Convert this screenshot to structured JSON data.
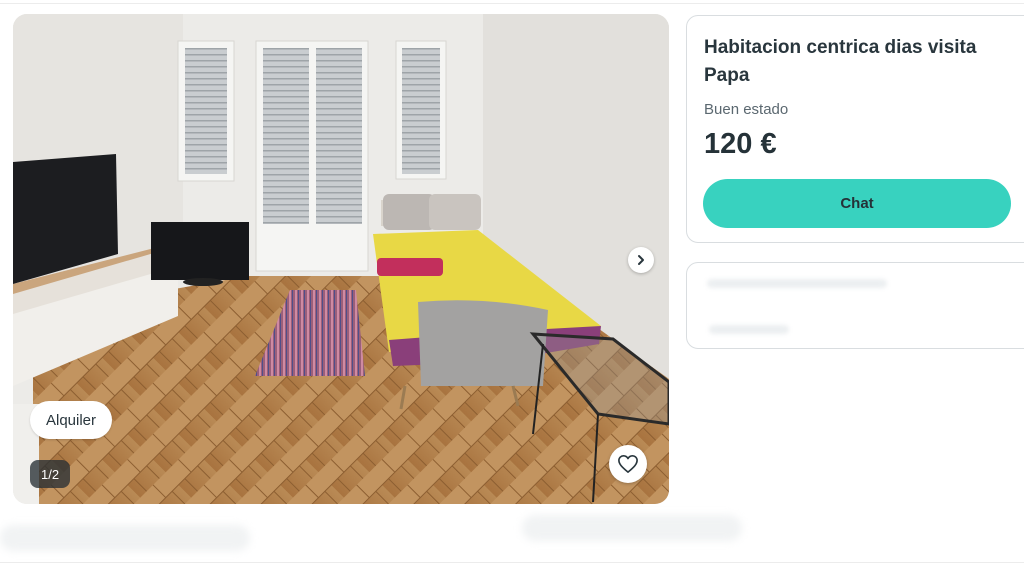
{
  "listing": {
    "title": "Habitacion centrica dias visita Papa",
    "condition": "Buen estado",
    "price": "120 €",
    "chat_label": "Chat"
  },
  "gallery": {
    "category_tag": "Alquiler",
    "counter": "1/2",
    "next_icon": "chevron-right-icon",
    "favorite_icon": "heart-outline-icon"
  },
  "colors": {
    "accent": "#38d2bf",
    "text_dark": "#253238",
    "text_muted": "#5b6870",
    "border": "#d9dde0"
  }
}
